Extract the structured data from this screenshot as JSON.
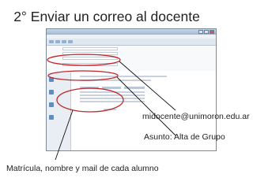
{
  "slide": {
    "title": "2° Enviar un correo al docente"
  },
  "annotations": {
    "email": "midocente@unimoron.edu.ar",
    "subject": "Asunto:  Alta de Grupo",
    "students": "Matrícula, nombre y mail de cada alumno"
  },
  "colors": {
    "annotation_line": "#c0262d",
    "title_text": "#222222"
  }
}
